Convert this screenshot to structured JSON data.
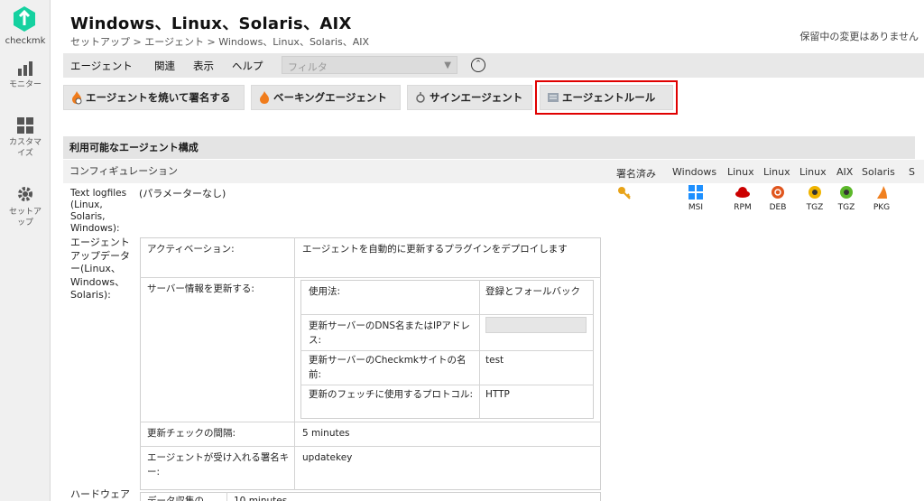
{
  "sidebar": {
    "logo_text": "checkmk",
    "items": [
      {
        "label": "モニター",
        "icon": "bar-chart-icon"
      },
      {
        "label": "カスタマイズ",
        "icon": "grid-icon"
      },
      {
        "label": "セットアップ",
        "icon": "gear-icon"
      }
    ]
  },
  "header": {
    "title": "Windows、Linux、Solaris、AIX",
    "breadcrumb": "セットアップ > エージェント > Windows、Linux、Solaris、AIX",
    "pending": "保留中の変更はありません"
  },
  "menubar": {
    "items": [
      "エージェント",
      "関連",
      "表示",
      "ヘルプ"
    ],
    "filter_placeholder": "フィルタ"
  },
  "toolbar": {
    "bake_sign": "エージェントを焼いて署名する",
    "bake": "ベーキングエージェント",
    "sign": "サインエージェント",
    "rules": "エージェントルール"
  },
  "section": {
    "title": "利用可能なエージェント構成",
    "config_header": "コンフィギュレーション",
    "columns": [
      "署名済み",
      "Windows",
      "Linux",
      "Linux",
      "Linux",
      "AIX",
      "Solaris",
      "S"
    ]
  },
  "row1": {
    "label": "Text logfiles (Linux, Solaris, Windows):",
    "value": "(パラメーターなし)",
    "packages": [
      {
        "label": "MSI",
        "icon": "windows-icon",
        "color": "#1e90ff"
      },
      {
        "label": "RPM",
        "icon": "redhat-icon",
        "color": "#cc0000"
      },
      {
        "label": "DEB",
        "icon": "debian-icon",
        "color": "#e0561e"
      },
      {
        "label": "TGZ",
        "icon": "linux-tgz-icon",
        "color": "#f0b400"
      },
      {
        "label": "TGZ",
        "icon": "aix-tgz-icon",
        "color": "#5cb82a"
      },
      {
        "label": "PKG",
        "icon": "solaris-icon",
        "color": "#f08020"
      }
    ]
  },
  "updater": {
    "label": "エージェントアップデーター(Linux、Windows、Solaris):",
    "activation_label": "アクティベーション:",
    "activation_value": "エージェントを自動的に更新するプラグインをデプロイします",
    "server_info_label": "サーバー情報を更新する:",
    "usage_label": "使用法:",
    "usage_value": "登録とフォールバック",
    "dns_label": "更新サーバーのDNS名またはIPアドレス:",
    "site_label": "更新サーバーのCheckmkサイトの名前:",
    "site_value": "test",
    "protocol_label": "更新のフェッチに使用するプロトコル:",
    "protocol_value": "HTTP",
    "interval_label": "更新チェックの間隔:",
    "interval_value": "5 minutes",
    "key_label": "エージェントが受け入れる署名キー:",
    "key_value": "updatekey"
  },
  "hardware": {
    "label": "ハードウェア",
    "sub_label": "データ収集の",
    "sub_value": "10 minutes"
  }
}
